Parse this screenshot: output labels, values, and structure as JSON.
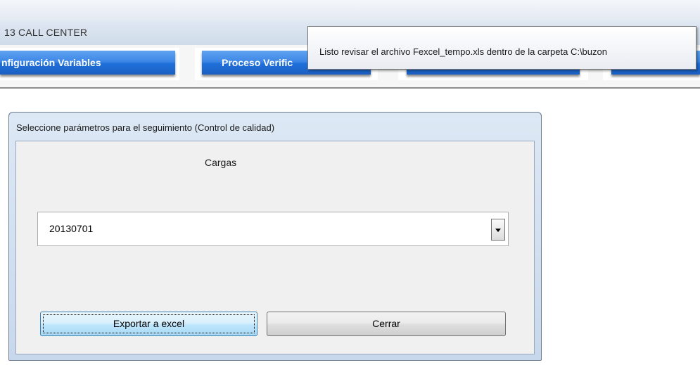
{
  "window": {
    "title": "13   CALL CENTER"
  },
  "tabs": [
    {
      "label": "nfiguración Variables"
    },
    {
      "label": "Proceso Verific"
    },
    {
      "label": ""
    },
    {
      "label": ""
    }
  ],
  "tooltip": {
    "text": "Listo revisar el archivo Fexcel_tempo.xls dentro de la carpeta C:\\buzon"
  },
  "dialog": {
    "title": "Seleccione parámetros para el seguimiento (Control de calidad)",
    "cargas_label": "Cargas",
    "combo": {
      "selected": "20130701"
    },
    "export_button": "Exportar a excel",
    "close_button": "Cerrar"
  },
  "colors": {
    "tab_blue": "#1f6fd9",
    "dialog_frame": "#c8d8ec",
    "client_bg": "#f0f0f0"
  }
}
